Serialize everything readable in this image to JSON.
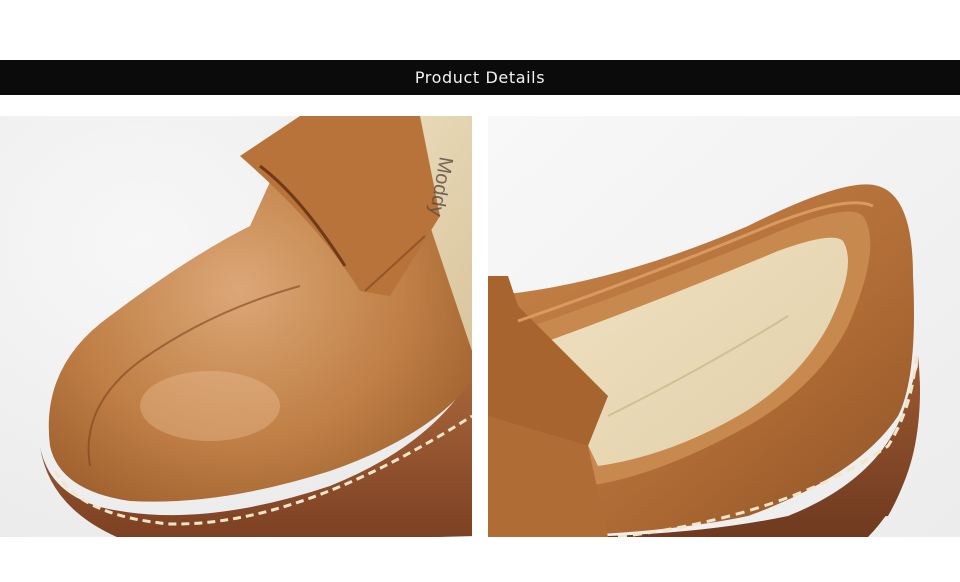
{
  "banner": {
    "title": "Product Details"
  },
  "photos": [
    {
      "alt": "Close-up of brown leather penny loafer toe",
      "insole_brand": "Moddy"
    },
    {
      "alt": "Close-up of brown leather loafer heel and insole"
    }
  ],
  "colors": {
    "banner_bg": "#0b0b0b",
    "leather": "#b8733a",
    "sole": "#8a4a2a",
    "stitch": "#f3e6c8"
  }
}
